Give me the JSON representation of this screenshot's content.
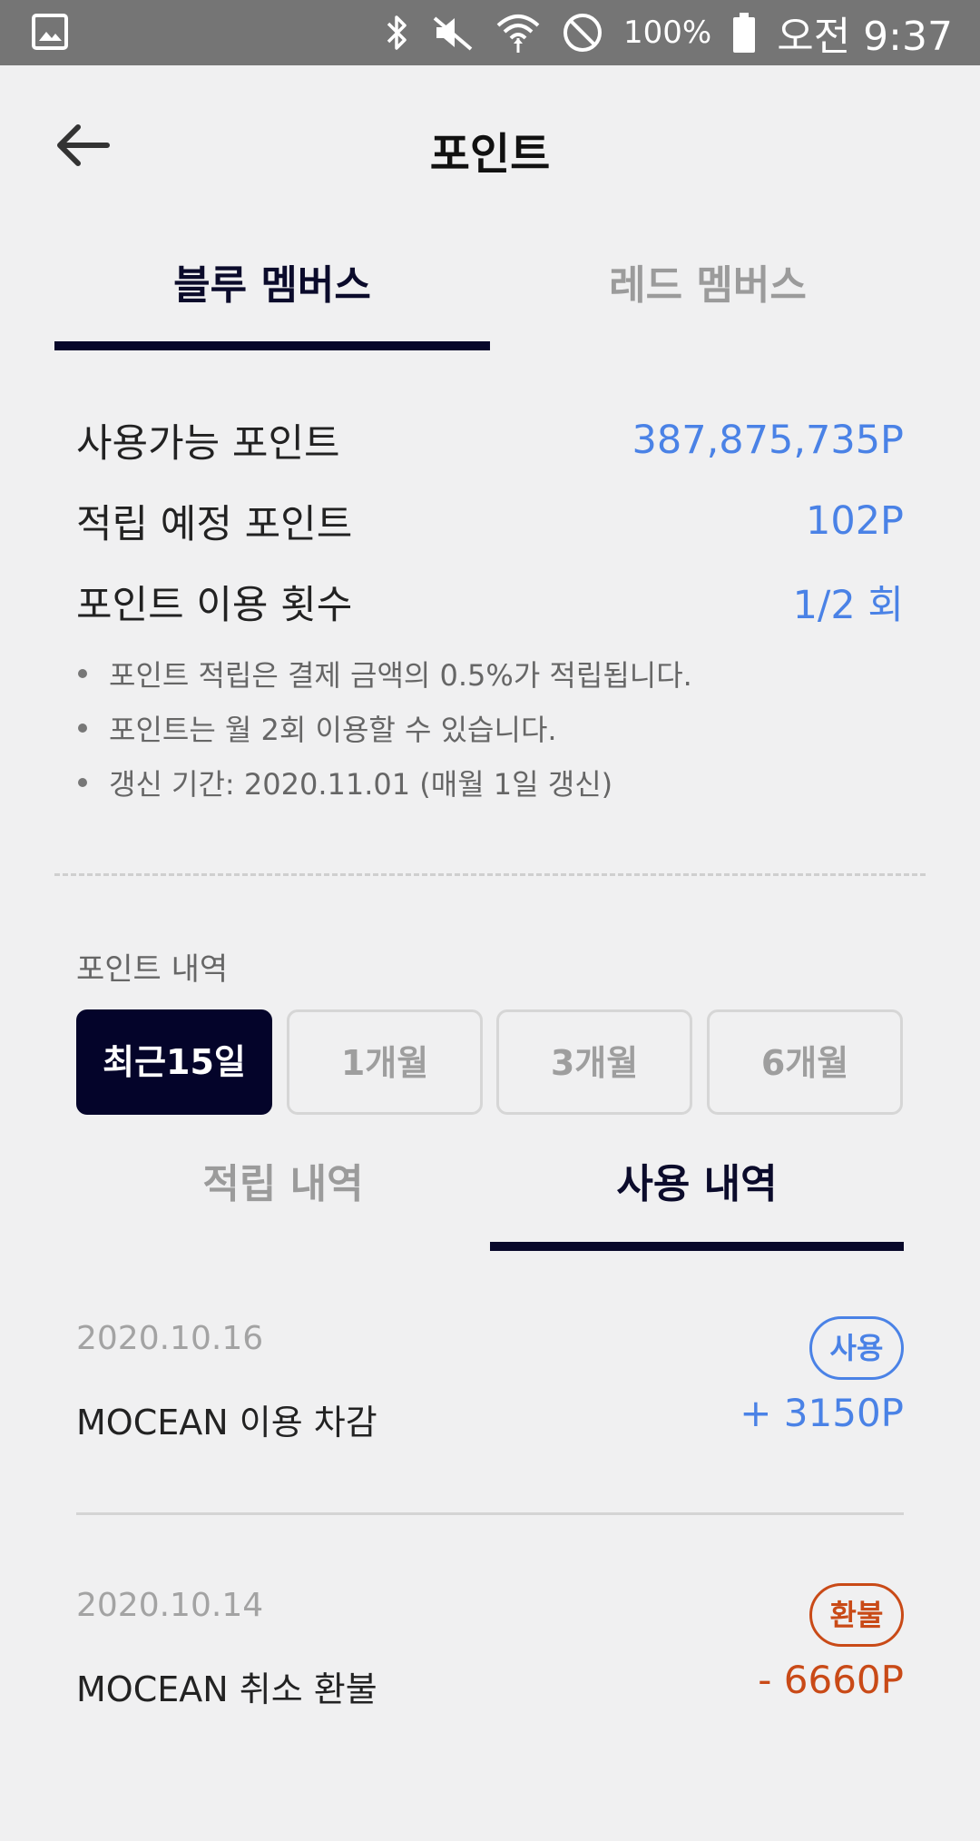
{
  "status_bar": {
    "icons_left": [
      "gallery-icon"
    ],
    "icons_right": [
      "bluetooth-icon",
      "vibrate-off-icon",
      "wifi-icon",
      "do-not-disturb-icon"
    ],
    "battery_text": "100%",
    "time": "오전 9:37"
  },
  "header": {
    "title": "포인트"
  },
  "member_tabs": [
    {
      "label": "블루 멤버스",
      "active": true
    },
    {
      "label": "레드 멤버스",
      "active": false
    }
  ],
  "points": [
    {
      "label": "사용가능 포인트",
      "value": "387,875,735P"
    },
    {
      "label": "적립 예정 포인트",
      "value": "102P"
    },
    {
      "label": "포인트 이용 횟수",
      "value": "1/2 회"
    }
  ],
  "notes": [
    "포인트 적립은 결제 금액의 0.5%가 적립됩니다.",
    "포인트는 월 2회 이용할 수 있습니다.",
    "갱신 기간: 2020.11.01 (매월 1일 갱신)"
  ],
  "history": {
    "label": "포인트 내역",
    "periods": [
      {
        "label": "최근15일",
        "active": true
      },
      {
        "label": "1개월",
        "active": false
      },
      {
        "label": "3개월",
        "active": false
      },
      {
        "label": "6개월",
        "active": false
      }
    ],
    "tabs": [
      {
        "label": "적립 내역",
        "active": false
      },
      {
        "label": "사용 내역",
        "active": true
      }
    ],
    "transactions": [
      {
        "date": "2020.10.16",
        "badge": "사용",
        "description": "MOCEAN 이용 차감",
        "amount": "+ 3150P",
        "color": "#4a82e6"
      },
      {
        "date": "2020.10.14",
        "badge": "환불",
        "description": "MOCEAN 취소 환불",
        "amount": "- 6660P",
        "color": "#c94a17"
      }
    ]
  },
  "colors": {
    "accent_blue": "#4a82e6",
    "refund_orange": "#c94a17",
    "navy": "#08082a",
    "background": "#f0f0f1"
  }
}
